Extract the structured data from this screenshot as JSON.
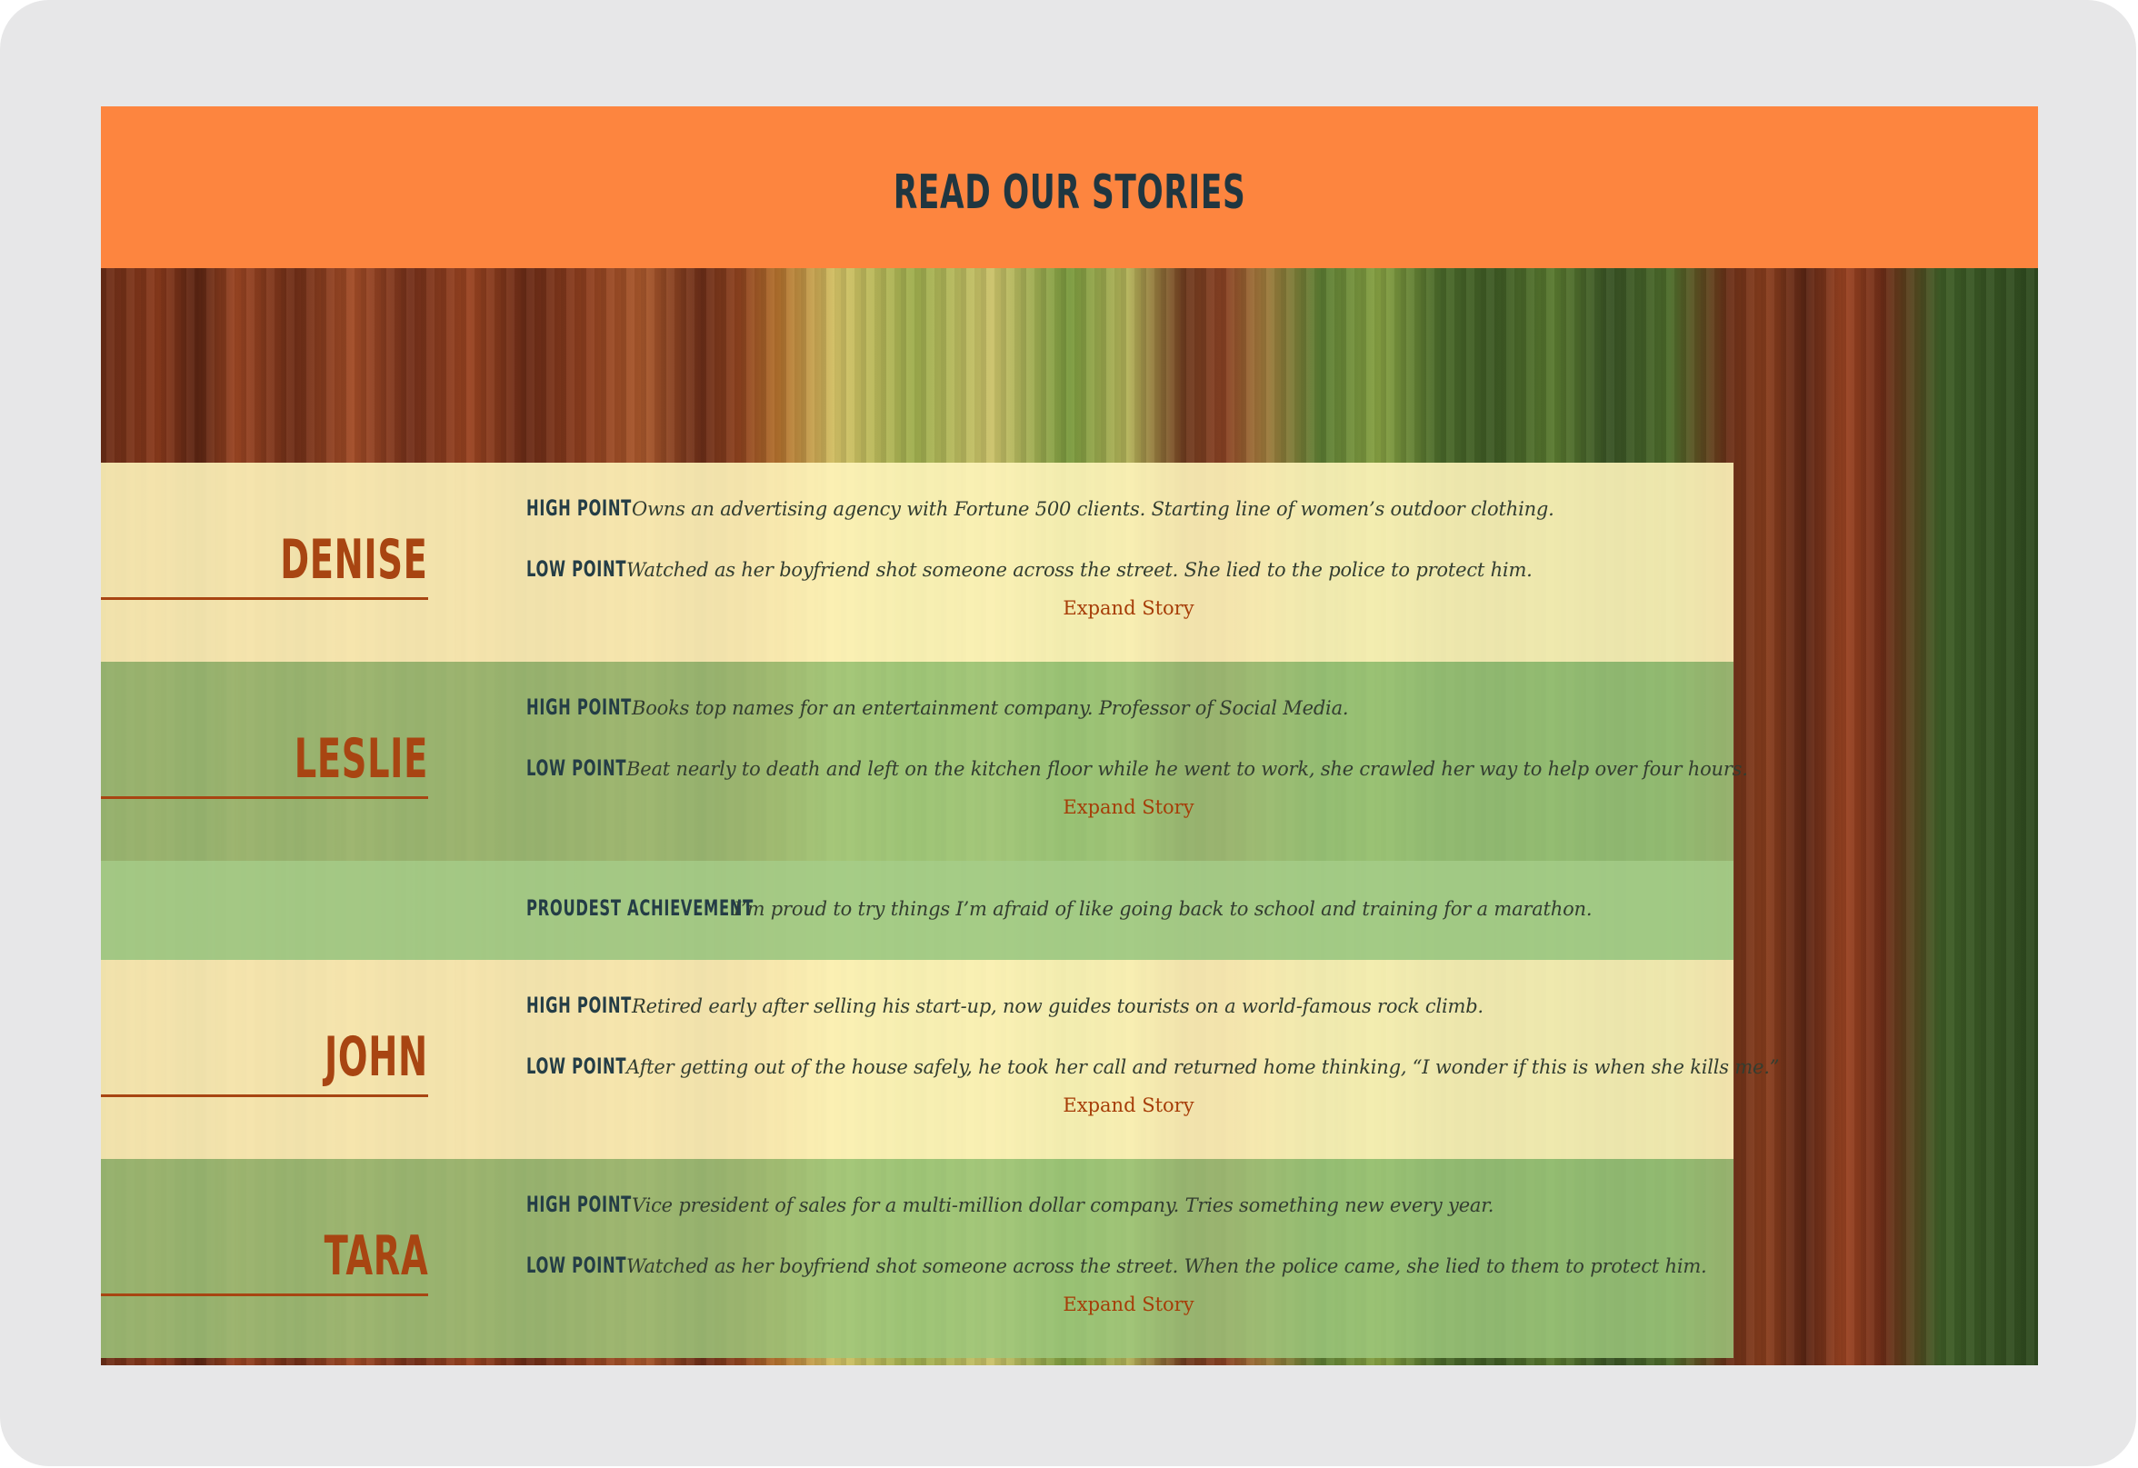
{
  "header": {
    "title": "READ OUR STORIES",
    "color": "#fd853f"
  },
  "labels": {
    "high": "HIGH POINT",
    "low": "LOW POINT",
    "proudest": "PROUDEST ACHIEVEMENT"
  },
  "stories": [
    {
      "name": "DENISE",
      "high": "Owns an advertising agency with Fortune 500 clients. Starting line of women’s outdoor clothing.",
      "low": "Watched as her boyfriend shot someone across the street. She lied to the police to protect him.",
      "expand": "Expand Story"
    },
    {
      "name": "LESLIE",
      "high": "Books top names for an entertainment company. Professor of Social Media.",
      "low": "Beat nearly to death and left on the kitchen floor while he went to work, she crawled her way to help over four hours.",
      "expand": "Expand Story",
      "proudest": "I’m proud to try things I’m afraid of like going back to school and training for a marathon."
    },
    {
      "name": "JOHN",
      "high": "Retired early after selling his start-up, now guides tourists on a world-famous rock climb.",
      "low": "After getting out of the house safely, he took her call and returned home thinking, “I wonder if this is when she kills me.”",
      "expand": "Expand Story"
    },
    {
      "name": "TARA",
      "high": "Vice president of sales for a multi-million dollar company. Tries something new every year.",
      "low": "Watched as her boyfriend shot someone across the street. When the police came, she lied to them to protect him.",
      "expand": "Expand Story"
    }
  ]
}
